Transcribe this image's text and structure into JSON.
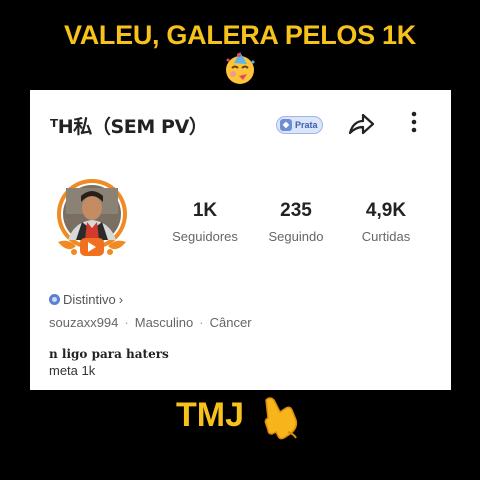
{
  "overlay": {
    "top_caption": "VALEU, GALERA PELOS 1K",
    "top_emoji": "partying-face-emoji",
    "bottom_caption": "TMJ",
    "bottom_emoji": "call-me-hand-emoji",
    "caption_color": "#f7c21b"
  },
  "profile": {
    "name": "ᵀH私（SEM PV）",
    "badge_label": "Prata",
    "badge_color": "#3b5fae",
    "avatar_emblem_color": "#f08a24",
    "stats": [
      {
        "value": "1K",
        "label": "Seguidores"
      },
      {
        "value": "235",
        "label": "Seguindo"
      },
      {
        "value": "4,9K",
        "label": "Curtidas"
      }
    ],
    "distintivo_label": "Distintivo",
    "username": "souzaxx994",
    "gender": "Masculino",
    "sign": "Câncer",
    "separator": "·",
    "bio_line1": "n ligo para haters",
    "bio_line2": "meta 1k"
  },
  "icons": {
    "share": "share-icon",
    "more": "more-vertical-icon",
    "chevron": "chevron-right-icon",
    "distintivo": "badge-icon"
  }
}
